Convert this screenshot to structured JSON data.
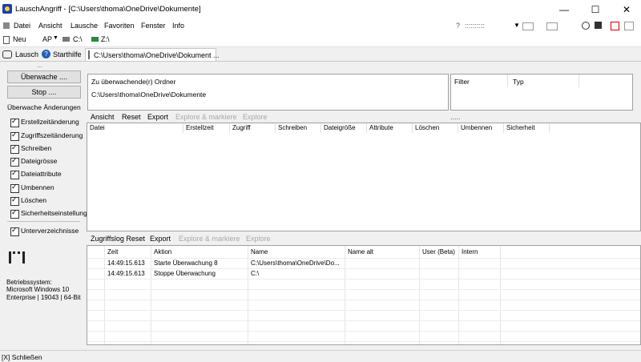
{
  "window": {
    "title": "LauschAngriff - [C:\\Users\\thoma\\OneDrive\\Dokumente]",
    "minimize": "—",
    "maximize": "☐",
    "close": "✕"
  },
  "menu": {
    "items": [
      "Datei",
      "Ansicht",
      "Lausche",
      "Favoriten",
      "Fenster",
      "Info"
    ],
    "help": "?",
    "dots": "::::::::::"
  },
  "quickbar": {
    "new_label": "Neu",
    "ap_label": "AP",
    "drive_c": "C:\\",
    "drive_z": "Z:\\"
  },
  "tabs": {
    "lausch": "Lausch",
    "starthilfe": "Starthilfe",
    "path": "C:\\Users\\thoma\\OneDrive\\Dokument ..."
  },
  "left": {
    "dots": "...",
    "watch_button": "Überwache ....",
    "stop_button": "Stop ....",
    "section_label": "Überwache Änderungen",
    "checkboxes": [
      "Erstellzeitänderung",
      "Zugriffszeitänderung",
      "Schreiben",
      "Dateigrösse",
      "Dateiattribute",
      "Umbennen",
      "Löschen",
      "Sicherheitseinstellung"
    ],
    "subfolders": "Unterverzeichnisse",
    "os_label": "Betriebssystem:",
    "os_name": "Microsoft Windows 10",
    "os_edition": "Enterprise | 19043 | 64-Bit"
  },
  "folder_panel": {
    "header": "Zu überwachende(r) Ordner",
    "path": "C:\\Users\\thoma\\OneDrive\\Dokumente"
  },
  "filter_panel": {
    "filter_col": "Filter",
    "type_col": "Typ"
  },
  "top_toolbar": {
    "ansicht": "Ansicht",
    "reset": "Reset",
    "export": "Export",
    "explore_mark": "Explore & markiere",
    "explore": "Explore",
    "dots": "....."
  },
  "files_table": {
    "columns": [
      "Datei",
      "Erstellzeit",
      "Zugriff",
      "Schreiben",
      "Dateigröße",
      "Attribute",
      "Löschen",
      "Umbennen",
      "Sicherheit"
    ]
  },
  "log_toolbar": {
    "title": "Zugriffslog Reset",
    "export": "Export",
    "explore_mark": "Explore & markiere",
    "explore": "Explore"
  },
  "log_table": {
    "columns": [
      "Zeit",
      "Aktion",
      "Name",
      "Name alt",
      "User (Beta)",
      "Intern"
    ],
    "rows": [
      {
        "zeit": "14:49:15.613",
        "aktion": "Starte Überwachung 8",
        "name": "C:\\Users\\thoma\\OneDrive\\Do..."
      },
      {
        "zeit": "14:49:15.613",
        "aktion": "Stoppe Überwachung",
        "name": "C:\\"
      }
    ]
  },
  "status": {
    "close": "[X] Schließen"
  }
}
